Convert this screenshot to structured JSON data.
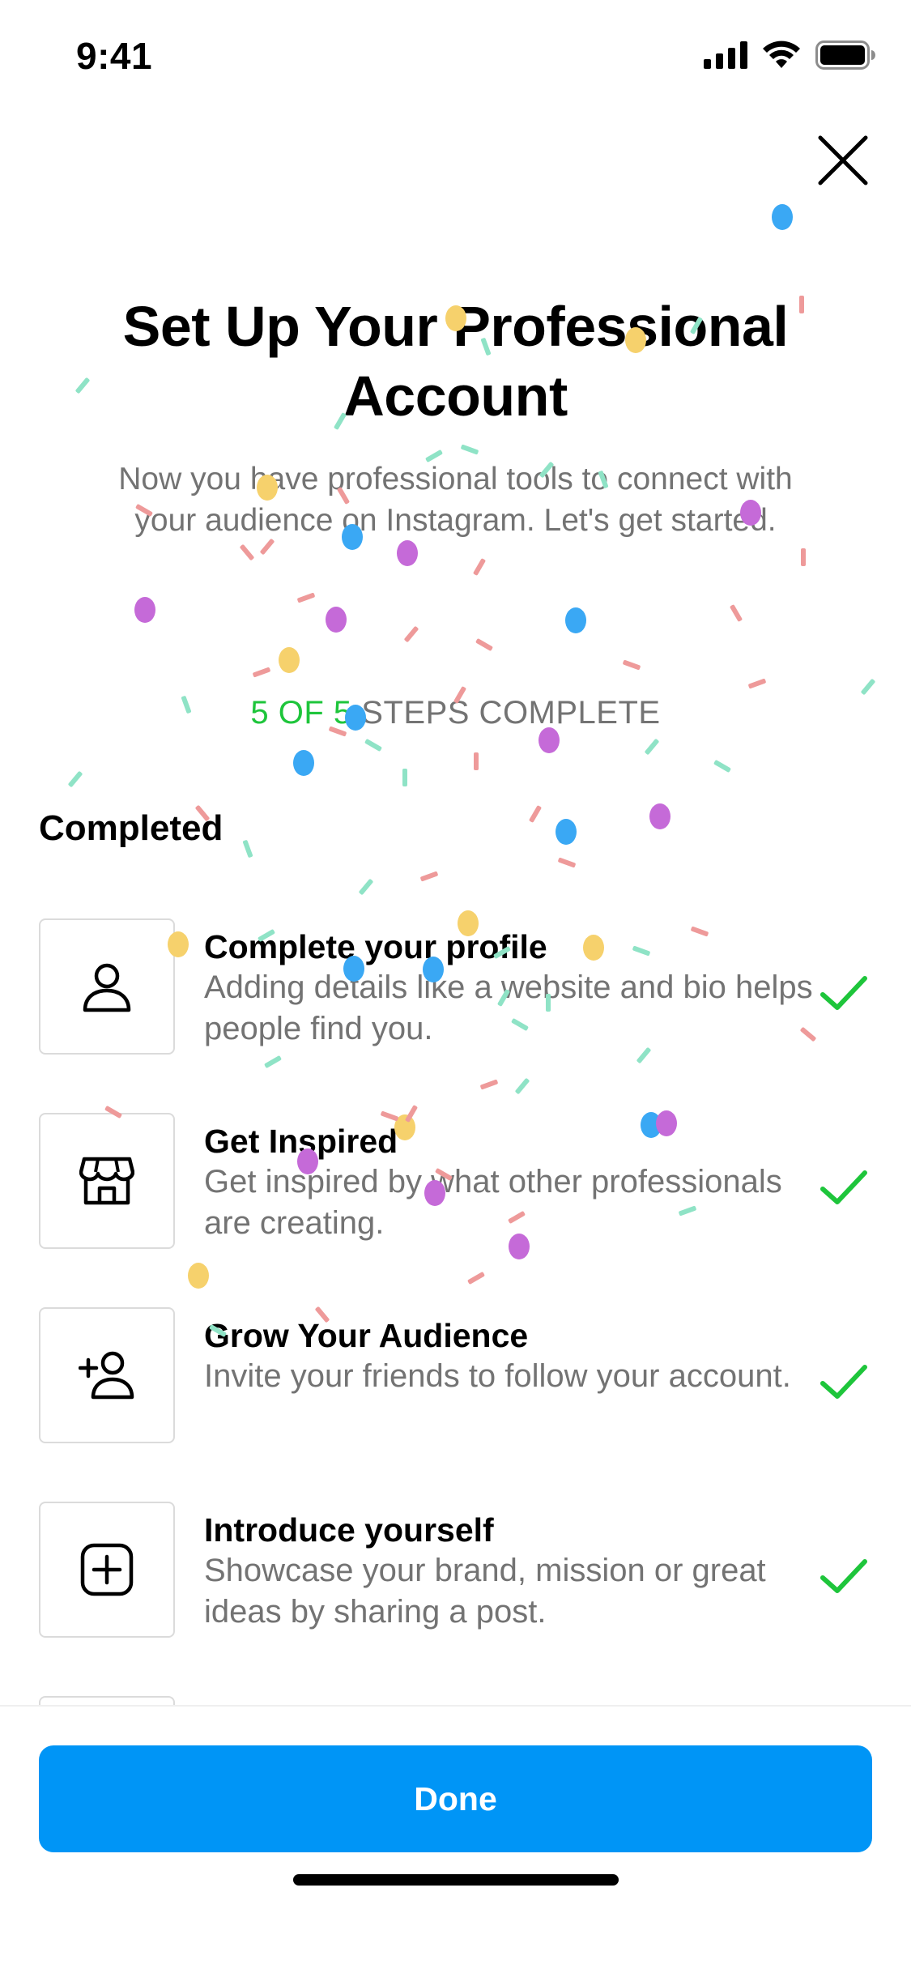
{
  "status_bar": {
    "time": "9:41",
    "icons": [
      "signal-icon",
      "wifi-icon",
      "battery-icon"
    ]
  },
  "close_icon": "close-icon",
  "title": "Set Up Your Professional Account",
  "subtitle": "Now you have professional tools to connect with your audience on Instagram. Let's get started.",
  "progress": {
    "done_text": "5 OF 5",
    "rest_text": " STEPS COMPLETE",
    "completed": 5,
    "total": 5
  },
  "section_title": "Completed",
  "steps": [
    {
      "title": "Complete your profile",
      "description": "Adding details like a website and bio helps people find you.",
      "icon": "person-icon",
      "completed": true
    },
    {
      "title": "Get Inspired",
      "description": "Get inspired by what other professionals are creating.",
      "icon": "shop-icon",
      "completed": true
    },
    {
      "title": "Grow Your Audience",
      "description": "Invite your friends to follow your account.",
      "icon": "add-person-icon",
      "completed": true
    },
    {
      "title": "Introduce yourself",
      "description": "Showcase your brand, mission or great ideas by sharing a post.",
      "icon": "add-post-icon",
      "completed": true
    }
  ],
  "done_button": {
    "label": "Done"
  },
  "colors": {
    "accent": "#0095f6",
    "success": "#1ec53b",
    "secondary_text": "#737373",
    "confetti": [
      "#3aa8f4",
      "#c56ad8",
      "#f6d16c",
      "#8fe3c6",
      "#ee9a9a"
    ]
  }
}
